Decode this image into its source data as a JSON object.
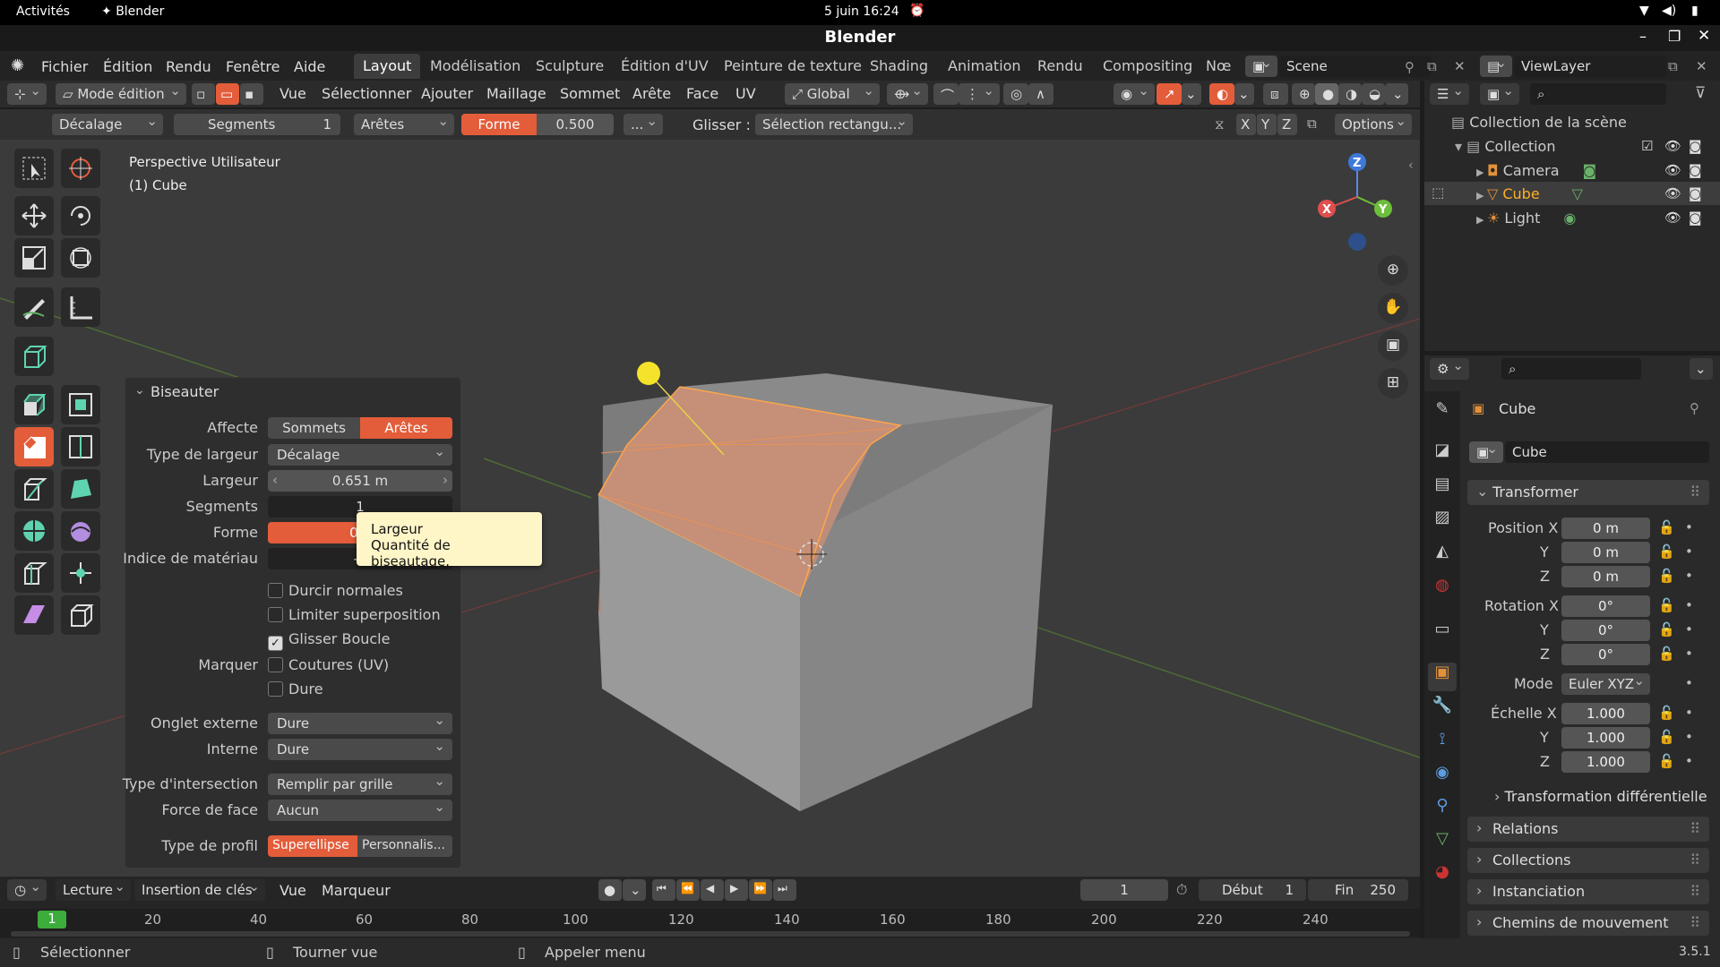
{
  "system": {
    "activities": "Activités",
    "app": "Blender",
    "datetime": "5 juin  16:24"
  },
  "window": {
    "title": "Blender"
  },
  "menus": [
    "Fichier",
    "Édition",
    "Rendu",
    "Fenêtre",
    "Aide"
  ],
  "workspaces": [
    "Layout",
    "Modélisation",
    "Sculpture",
    "Édition d'UV",
    "Peinture de texture",
    "Shading",
    "Animation",
    "Rendu",
    "Compositing",
    "Nœ"
  ],
  "scene": "Scene",
  "viewlayer": "ViewLayer",
  "header": {
    "mode": "Mode édition",
    "menus": [
      "Vue",
      "Sélectionner",
      "Ajouter",
      "Maillage",
      "Sommet",
      "Arête",
      "Face",
      "UV"
    ],
    "orientation": "Global"
  },
  "toolsettings": {
    "type": "Décalage",
    "segments_label": "Segments",
    "segments_value": "1",
    "affect": "Arêtes",
    "shape_label": "Forme",
    "shape_value": "0.500",
    "more": "...",
    "glisser_label": "Glisser :",
    "glisser_value": "Sélection rectangu...",
    "axes": [
      "X",
      "Y",
      "Z"
    ],
    "options": "Options"
  },
  "viewport": {
    "view_name": "Perspective Utilisateur",
    "object_name": "(1) Cube"
  },
  "bevel_panel": {
    "title": "Biseauter",
    "affecte_label": "Affecte",
    "affecte_options": [
      "Sommets",
      "Arêtes"
    ],
    "largeur_type_label": "Type de largeur",
    "largeur_type_value": "Décalage",
    "largeur_label": "Largeur",
    "largeur_value": "0.651 m",
    "segments_label": "Segments",
    "segments_value": "1",
    "forme_label": "Forme",
    "forme_value": "0.5",
    "material_label": "Indice de matériau",
    "material_value": "-1",
    "checks": [
      {
        "label": "Durcir normales",
        "checked": false
      },
      {
        "label": "Limiter superposition",
        "checked": false
      },
      {
        "label": "Glisser Boucle",
        "checked": true
      }
    ],
    "marquer_label": "Marquer",
    "marquer_checks": [
      {
        "label": "Coutures (UV)",
        "checked": false
      },
      {
        "label": "Dure",
        "checked": false
      }
    ],
    "onglet_externe_label": "Onglet externe",
    "onglet_externe_value": "Dure",
    "interne_label": "Interne",
    "interne_value": "Dure",
    "intersection_label": "Type d'intersection",
    "intersection_value": "Remplir par grille",
    "face_force_label": "Force de face",
    "face_force_value": "Aucun",
    "profile_label": "Type de profil",
    "profile_options": [
      "Superellipse",
      "Personnalis..."
    ]
  },
  "tooltip": {
    "title": "Largeur",
    "description": "Quantité de biseautage."
  },
  "gizmo": {
    "x": "X",
    "y": "Y",
    "z": "Z"
  },
  "timeline": {
    "menus": [
      "Lecture",
      "Insertion de clés",
      "Vue",
      "Marqueur"
    ],
    "current_frame": "1",
    "start_label": "Début",
    "start_value": "1",
    "end_label": "Fin",
    "end_value": "250",
    "ruler": [
      "20",
      "40",
      "60",
      "80",
      "100",
      "120",
      "140",
      "160",
      "180",
      "200",
      "220",
      "240"
    ],
    "playhead": "1"
  },
  "status": {
    "select": "Sélectionner",
    "rotate": "Tourner vue",
    "menu": "Appeler menu",
    "version": "3.5.1"
  },
  "outliner": {
    "root": "Collection de la scène",
    "collection": "Collection",
    "items": [
      "Camera",
      "Cube",
      "Light"
    ]
  },
  "properties": {
    "object_name": "Cube",
    "datablock": "Cube",
    "transform_title": "Transformer",
    "position_label": "Position X",
    "rotation_label": "Rotation X",
    "scale_label": "Échelle X",
    "y": "Y",
    "z": "Z",
    "position": [
      "0 m",
      "0 m",
      "0 m"
    ],
    "rotation": [
      "0°",
      "0°",
      "0°"
    ],
    "mode_label": "Mode",
    "mode_value": "Euler XYZ",
    "scale": [
      "1.000",
      "1.000",
      "1.000"
    ],
    "delta": "Transformation différentielle",
    "sections": [
      "Relations",
      "Collections",
      "Instanciation",
      "Chemins de mouvement"
    ]
  },
  "colors": {
    "accent": "#e35d3a",
    "selected_text": "#ffaf29",
    "bevel_face": "#c9917a"
  }
}
